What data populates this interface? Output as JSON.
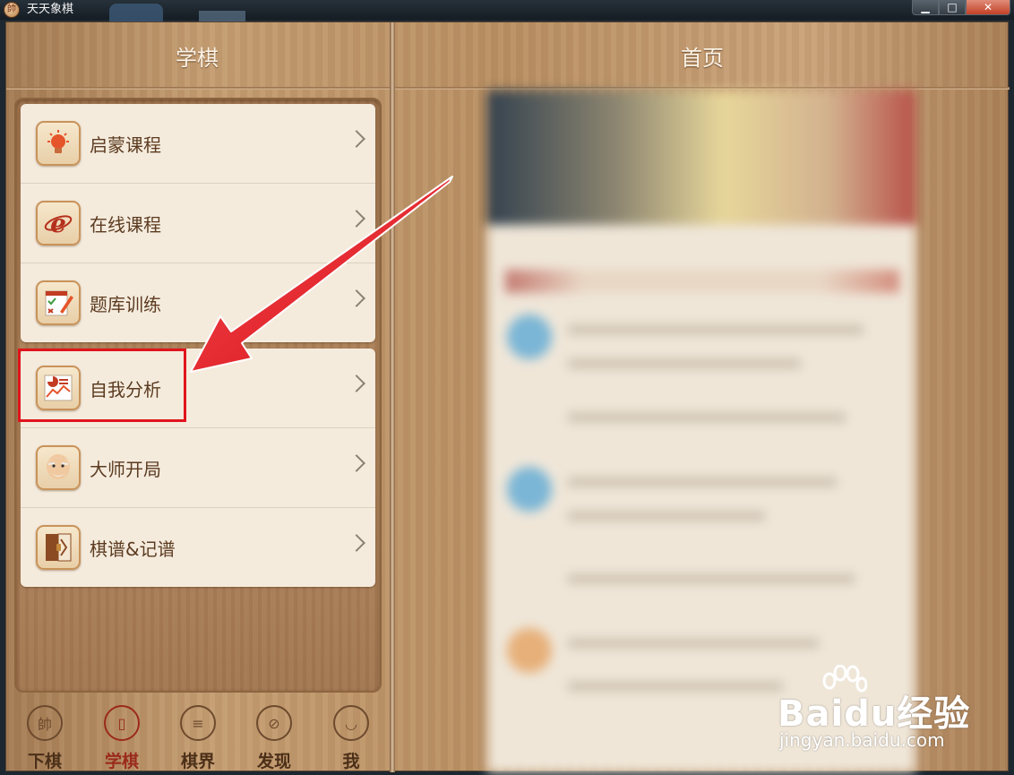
{
  "window": {
    "title": "天天象棋",
    "buttons": {
      "minimize": "▁",
      "maximize": "□",
      "close": "✕"
    }
  },
  "left_panel": {
    "title": "学棋",
    "menu_groups": [
      [
        {
          "label": "启蒙课程",
          "icon": "lightbulb-icon"
        },
        {
          "label": "在线课程",
          "icon": "online-e-icon"
        },
        {
          "label": "题库训练",
          "icon": "checklist-pencil-icon"
        }
      ],
      [
        {
          "label": "自我分析",
          "icon": "analysis-chart-icon",
          "highlighted": true
        },
        {
          "label": "大师开局",
          "icon": "master-face-icon"
        },
        {
          "label": "棋谱&记谱",
          "icon": "record-book-icon"
        }
      ]
    ]
  },
  "right_panel": {
    "title": "首页",
    "content_state": "blurred"
  },
  "tabbar": {
    "tabs": [
      {
        "label": "下棋",
        "glyph": "帥",
        "icon": "chess-piece-icon",
        "active": false
      },
      {
        "label": "学棋",
        "glyph": "▯",
        "icon": "book-icon",
        "active": true
      },
      {
        "label": "棋界",
        "glyph": "≡",
        "icon": "chat-icon",
        "active": false
      },
      {
        "label": "发现",
        "glyph": "⊘",
        "icon": "compass-icon",
        "active": false
      },
      {
        "label": "我",
        "glyph": "◡",
        "icon": "person-icon",
        "active": false
      }
    ]
  },
  "watermark": {
    "brand": "Baidu经验",
    "url": "jingyan.baidu.com"
  },
  "colors": {
    "accent_active": "#9a2a1c",
    "highlight_box": "#e0141c",
    "arrow": "#e8131c"
  }
}
